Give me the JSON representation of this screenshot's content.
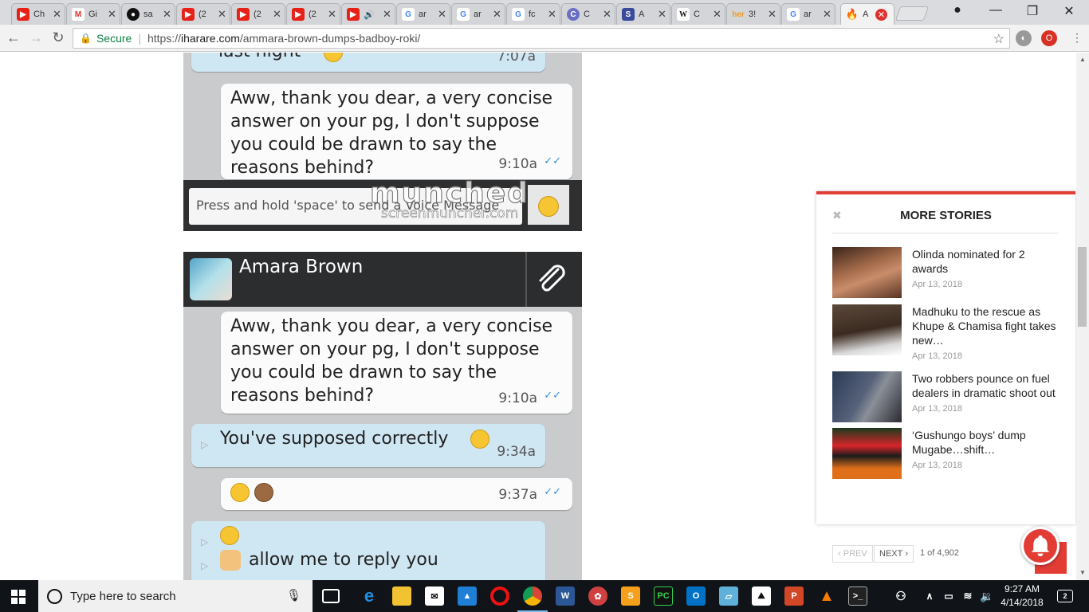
{
  "browser": {
    "tabs": [
      {
        "title": "Ch",
        "icon": "youtube-icon",
        "color": "#e62117"
      },
      {
        "title": "Gi",
        "icon": "gmail-icon",
        "color": "#d93025"
      },
      {
        "title": "sa",
        "icon": "github-icon",
        "color": "#111111"
      },
      {
        "title": "(2",
        "icon": "youtube-icon",
        "color": "#e62117"
      },
      {
        "title": "(2",
        "icon": "youtube-icon",
        "color": "#e62117"
      },
      {
        "title": "(2",
        "icon": "youtube-icon",
        "color": "#e62117"
      },
      {
        "title": "🔊",
        "icon": "youtube-icon",
        "color": "#e62117"
      },
      {
        "title": "ar",
        "icon": "google-icon",
        "color": "#4285f4"
      },
      {
        "title": "ar",
        "icon": "google-icon",
        "color": "#4285f4"
      },
      {
        "title": "fc",
        "icon": "google-icon",
        "color": "#4285f4"
      },
      {
        "title": "C",
        "icon": "app-icon",
        "color": "#6b6fc4"
      },
      {
        "title": "A",
        "icon": "s-icon",
        "color": "#3b4a9b"
      },
      {
        "title": "C",
        "icon": "wikipedia-icon",
        "color": "#ffffff"
      },
      {
        "title": "3!",
        "icon": "her-icon",
        "color": "#f29a1f"
      },
      {
        "title": "ar",
        "icon": "google-icon",
        "color": "#4285f4"
      },
      {
        "title": "A",
        "icon": "fire-icon",
        "color": "#ff7a00"
      }
    ],
    "url_secure_label": "Secure",
    "url_host": "iharare.com",
    "url_path": "/ammara-brown-dumps-badboy-roki/"
  },
  "chat1": {
    "partial_text": "last night",
    "partial_time": "7:07a",
    "message_text": "Aww, thank you dear, a very concise answer on your pg, I don't suppose you could be drawn to say the reasons behind?",
    "message_time": "9:10a",
    "input_placeholder": "Press and hold 'space' to send a Voice Message",
    "watermark": "munched",
    "watermark_sub": "screenmuncher.com"
  },
  "chat2": {
    "contact_name": "Amara Brown",
    "messages": [
      {
        "text": "Aww, thank you dear, a very concise answer on your pg, I don't suppose you could be drawn to say the reasons behind?",
        "time": "9:10a"
      },
      {
        "text": "You've supposed correctly",
        "time": "9:34a"
      },
      {
        "text": "",
        "time": "9:37a"
      },
      {
        "text": "allow me to reply you",
        "time": ""
      }
    ]
  },
  "stories": {
    "heading": "MORE STORIES",
    "items": [
      {
        "title": "Olinda nominated for 2 awards",
        "date": "Apr 13, 2018"
      },
      {
        "title": "Madhuku to the rescue as Khupe & Chamisa fight takes new…",
        "date": "Apr 13, 2018"
      },
      {
        "title": "Two robbers pounce on fuel dealers in dramatic shoot out",
        "date": "Apr 13, 2018"
      },
      {
        "title": "‘Gushungo boys’ dump Mugabe…shift…",
        "date": "Apr 13, 2018"
      }
    ],
    "prev_label": "PREV",
    "next_label": "NEXT",
    "page_info": "1 of 4,902"
  },
  "taskbar": {
    "search_placeholder": "Type here to search",
    "time": "9:27 AM",
    "date": "4/14/2018",
    "notification_count": "2"
  }
}
